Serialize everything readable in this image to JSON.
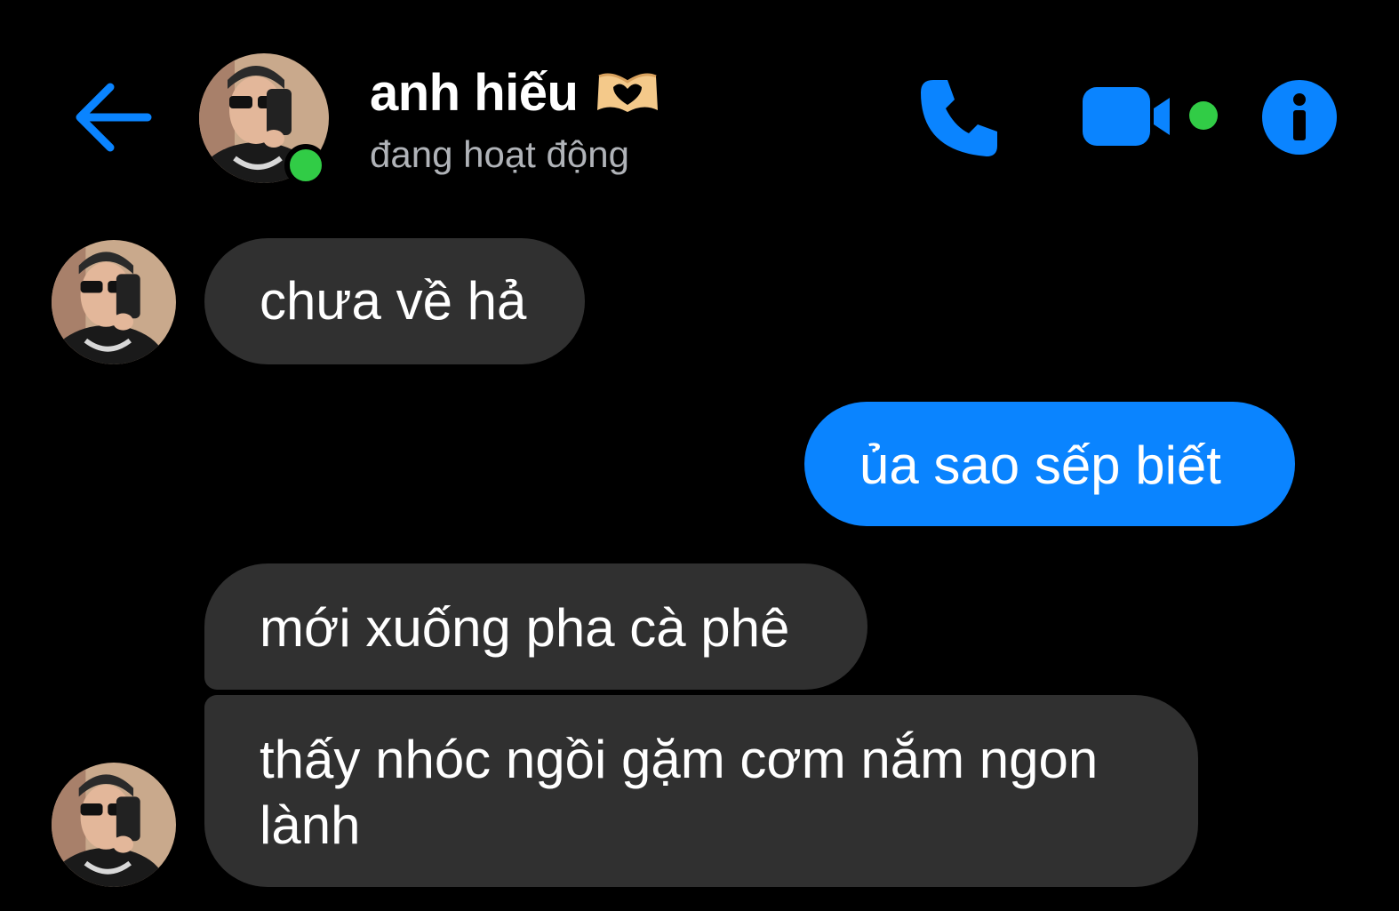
{
  "header": {
    "contact_name": "anh hiếu",
    "status": "đang hoạt động",
    "name_badge_emoji": "heart-hands-emoji",
    "online": true
  },
  "actions": {
    "back_icon": "arrow-left-icon",
    "call_icon": "phone-icon",
    "video_icon": "video-camera-icon",
    "info_icon": "info-icon"
  },
  "messages": [
    {
      "sender": "contact",
      "text": "chưa về hả"
    },
    {
      "sender": "me",
      "text": "ủa sao sếp biết"
    },
    {
      "sender": "contact",
      "text": "mới xuống pha cà phê"
    },
    {
      "sender": "contact",
      "text": "thấy nhóc ngồi gặm cơm nắm ngon lành"
    }
  ],
  "colors": {
    "background": "#000000",
    "accent": "#0a84ff",
    "incoming_bubble": "#303030",
    "online": "#31cc46",
    "status_text": "#b0b3b8"
  }
}
